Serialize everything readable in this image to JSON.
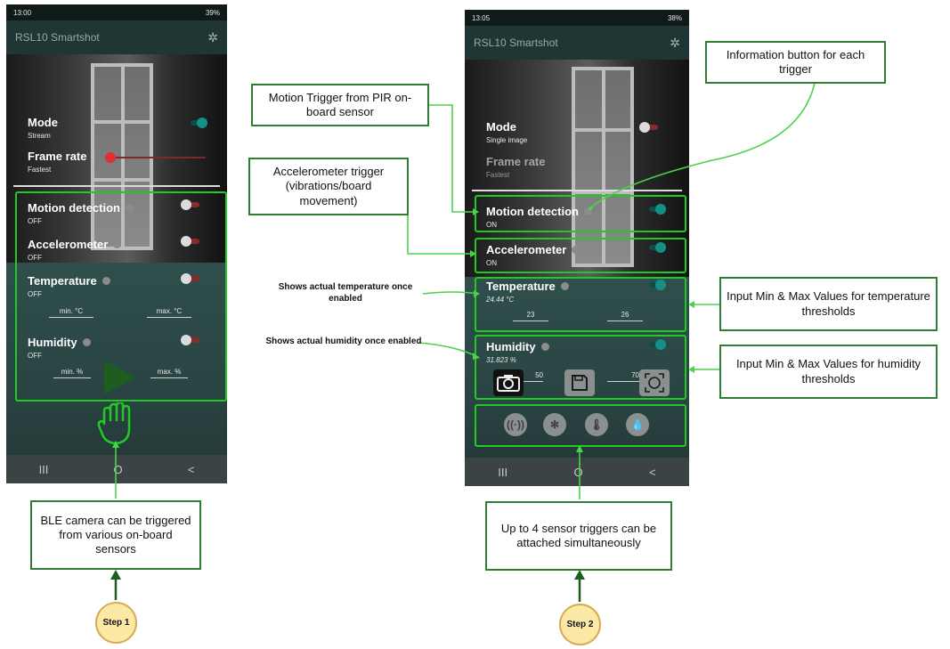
{
  "phone1": {
    "status_time": "13:00",
    "status_right": "39%",
    "app_title": "RSL10 Smartshot",
    "mode": {
      "label": "Mode",
      "value": "Stream"
    },
    "frame_rate": {
      "label": "Frame rate",
      "value": "Fastest"
    },
    "motion": {
      "label": "Motion detection",
      "value": "OFF"
    },
    "accel": {
      "label": "Accelerometer",
      "value": "OFF"
    },
    "temp": {
      "label": "Temperature",
      "value": "OFF",
      "min": "min. °C",
      "max": "max. °C"
    },
    "humid": {
      "label": "Humidity",
      "value": "OFF",
      "min": "min. %",
      "max": "max. %"
    },
    "nav": [
      "III",
      "O",
      "<"
    ]
  },
  "phone2": {
    "status_time": "13:05",
    "status_right": "38%",
    "app_title": "RSL10 Smartshot",
    "mode": {
      "label": "Mode",
      "value": "Single image"
    },
    "frame_rate": {
      "label": "Frame rate",
      "value": "Fastest"
    },
    "motion": {
      "label": "Motion detection",
      "value": "ON"
    },
    "accel": {
      "label": "Accelerometer",
      "value": "ON"
    },
    "temp": {
      "label": "Temperature",
      "value": "24.44 °C",
      "min": "23",
      "max": "26"
    },
    "humid": {
      "label": "Humidity",
      "value": "31.823 %",
      "min": "50",
      "max": "70"
    },
    "nav": [
      "III",
      "O",
      "<"
    ]
  },
  "callouts": {
    "info_button": "Information button for each trigger",
    "motion_trigger": "Motion Trigger from PIR on-board sensor",
    "accel_trigger": "Accelerometer trigger (vibrations/board movement)",
    "shows_temp": "Shows actual temperature once enabled",
    "shows_humid": "Shows actual humidity once enabled",
    "temp_thresholds": "Input Min & Max Values for temperature thresholds",
    "humid_thresholds": "Input Min & Max Values for humidity thresholds",
    "ble_camera": "BLE camera can be triggered from various on-board sensors",
    "up_to_4": "Up to 4 sensor triggers can be attached simultaneously"
  },
  "steps": {
    "step1": "Step 1",
    "step2": "Step 2"
  },
  "colors": {
    "callout_border": "#2e7d32",
    "highlight": "#22c922",
    "toggle_on": "#159086",
    "step_fill": "#fde9a6"
  },
  "icons": {
    "settings": "gear-icon",
    "hand": "hand-icon",
    "play": "play-icon",
    "camera": "camera-icon",
    "save": "save-icon",
    "face": "face-scan-icon",
    "triggers": [
      "motion-wave-icon",
      "vibration-icon",
      "thermometer-icon",
      "droplet-icon"
    ]
  }
}
